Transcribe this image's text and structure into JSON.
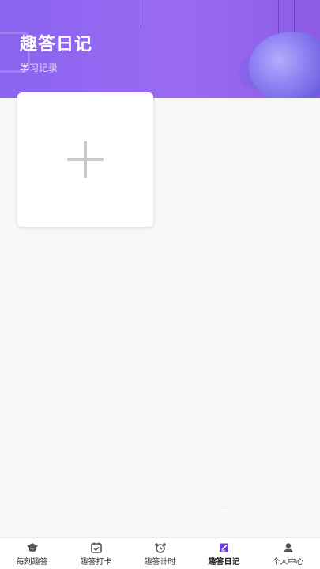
{
  "header": {
    "title": "趣答日记",
    "subtitle": "学习记录"
  },
  "main": {
    "add_card_icon": "plus-icon"
  },
  "watermark": "吐司下载站",
  "tabbar": {
    "active_index": 3,
    "items": [
      {
        "label": "每刻趣答",
        "icon": "graduation-cap-icon"
      },
      {
        "label": "趣答打卡",
        "icon": "calendar-check-icon"
      },
      {
        "label": "趣答计时",
        "icon": "alarm-clock-icon"
      },
      {
        "label": "趣答日记",
        "icon": "edit-note-icon"
      },
      {
        "label": "个人中心",
        "icon": "user-icon"
      }
    ]
  },
  "colors": {
    "header_gradient_start": "#8a63f0",
    "header_gradient_end": "#8c5ce6",
    "active_icon": "#6a3fd9",
    "inactive_icon": "#555555",
    "background": "#f7f7f7"
  }
}
